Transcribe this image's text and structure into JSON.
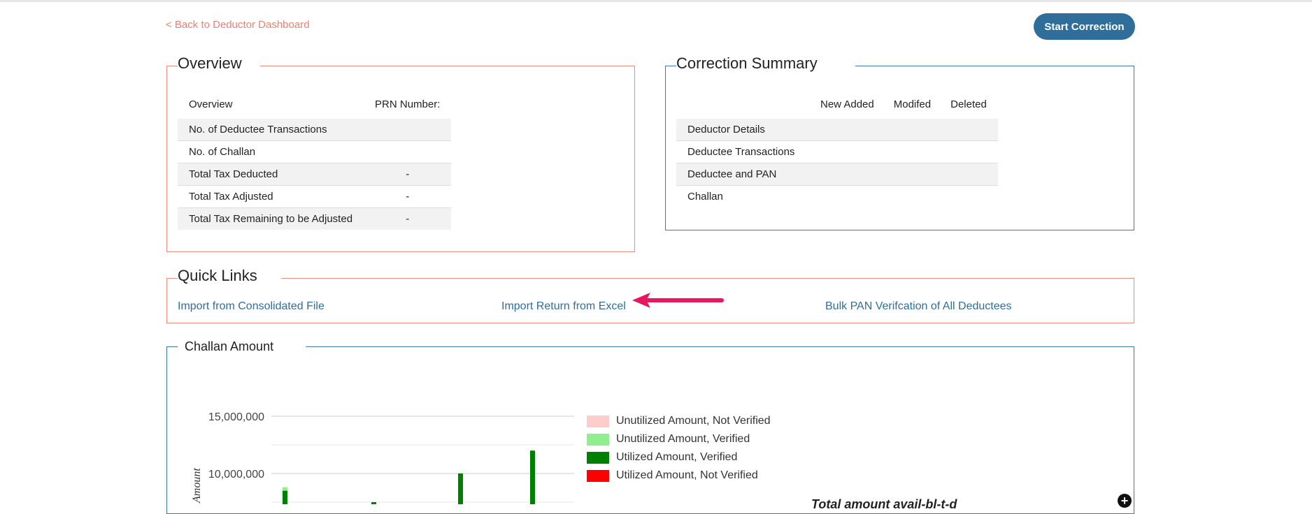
{
  "header": {
    "back_link": "< Back to Deductor Dashboard",
    "start_button": "Start Correction"
  },
  "overview": {
    "title": "Overview",
    "col_label": "Overview",
    "col_prn": "PRN Number:",
    "rows": [
      {
        "label": "No. of Deductee Transactions",
        "value": ""
      },
      {
        "label": "No. of Challan",
        "value": ""
      },
      {
        "label": "Total Tax Deducted",
        "value": "-"
      },
      {
        "label": "Total Tax Adjusted",
        "value": "-"
      },
      {
        "label": "Total Tax Remaining to be Adjusted",
        "value": "-"
      }
    ]
  },
  "correction_summary": {
    "title": "Correction Summary",
    "col_new": "New Added",
    "col_modified": "Modifed",
    "col_deleted": "Deleted",
    "rows": [
      {
        "label": "Deductor Details"
      },
      {
        "label": "Deductee Transactions"
      },
      {
        "label": "Deductee and PAN"
      },
      {
        "label": "Challan"
      }
    ]
  },
  "quick_links": {
    "title": "Quick Links",
    "link_consolidated": "Import from Consolidated File",
    "link_excel": "Import Return from Excel",
    "link_bulk_pan": "Bulk PAN Verifcation of All Deductees"
  },
  "challan_chart": {
    "title": "Challan Amount",
    "ylabel": "Amount",
    "tick_15m": "15,000,000",
    "tick_10m": "10,000,000",
    "partial_text": "Total amount avail-bl-t-d",
    "legend": [
      {
        "label": "Unutilized Amount, Not Verified",
        "color": "#ffcccc"
      },
      {
        "label": "Unutilized Amount, Verified",
        "color": "#90ee90"
      },
      {
        "label": "Utilized Amount, Verified",
        "color": "#008000"
      },
      {
        "label": "Utilized Amount, Not Verified",
        "color": "#ff0000"
      }
    ]
  },
  "chart_data": {
    "type": "bar",
    "title": "Challan Amount",
    "ylabel": "Amount",
    "ylim_visible": [
      8000000,
      15000000
    ],
    "series": [
      {
        "name": "Utilized Amount, Verified",
        "values": [
          8500000,
          7500000,
          10000000,
          12000000
        ]
      },
      {
        "name": "Unutilized Amount, Verified",
        "values": [
          300000,
          0,
          0,
          0
        ]
      }
    ]
  },
  "colors": {
    "accent_blue": "#2f6e9b",
    "accent_salmon": "#f07f70",
    "annotation_arrow": "#e8175d"
  }
}
